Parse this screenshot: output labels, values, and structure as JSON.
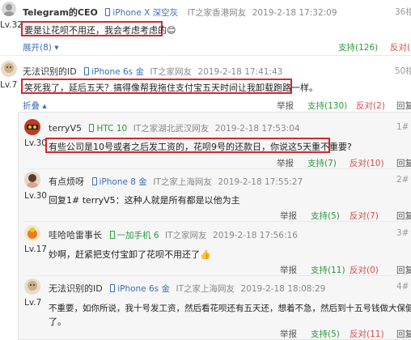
{
  "comments": [
    {
      "user": "Telegram的CEO",
      "device": "iPhone X 深空灰",
      "source": "IT之家香港网友",
      "time": "2019-2-18 17:32:09",
      "floor": "36楼",
      "level": "Lv.32",
      "content": "要是让花呗不用还，我会考虑考虑的😊",
      "expand": "展开(8)",
      "support": "支持(126)",
      "oppose": "反对(0"
    },
    {
      "user": "无法识别的ID",
      "device": "iPhone 6s 金",
      "source": "IT之家网友",
      "time": "2019-2-18 17:41:43",
      "floor": "50楼",
      "level": "Lv.7",
      "content": "笑死我了，延后五天？搞得像帮我拖住支付宝五天时间让我卸载跑路一样。",
      "collapse": "折叠",
      "report": "举报",
      "support": "支持(130)",
      "oppose": "反对(2)",
      "reply": "回复"
    }
  ],
  "replies": [
    {
      "user": "terryV5",
      "device": "HTC 10",
      "source": "IT之家湖北武汉网友",
      "time": "2019-2-18 17:53:04",
      "floor": "1#",
      "level": "Lv.30",
      "content": "有些公司是10号或者之后发工资的，花呗9号的还款日，你说这5天重不重要?",
      "report": "举报",
      "support": "支持(7)",
      "oppose": "反对(10)",
      "reply": "回复"
    },
    {
      "user": "有点烦呀",
      "device": "iPhone 8 金",
      "source": "IT之家上海网友",
      "time": "2019-2-18 17:55:27",
      "floor": "2#",
      "level": "Lv.30",
      "content": "回复1# terryV5：这种人就是所有都是以他为主",
      "report": "举报",
      "support": "支持(5)",
      "oppose": "反对(7)",
      "reply": "回复"
    },
    {
      "user": "哇哈哈雷事长",
      "device": "一加手机 6",
      "source": "IT之家网友",
      "time": "2019-2-18 17:56:16",
      "floor": "3#",
      "level": "Lv.17",
      "content": "妙啊，赶紧把支付宝卸了花呗不用还了👍",
      "report": "举报",
      "support": "支持(11)",
      "oppose": "反对(0)",
      "reply": "回复"
    },
    {
      "user": "无法识别的ID",
      "device": "iPhone 6s 金",
      "source": "IT之家上海网友",
      "time": "2019-2-18 18:08:29",
      "floor": "4#",
      "level": "Lv.7",
      "content_line1": "不重要，如你所说，我十号发工资，然后看花呗还有五天还，想着不急，然后到十五号钱做大保健花完",
      "content_line2": "了。",
      "report": "举报",
      "support": "支持(5)",
      "oppose": "反对(11)",
      "reply": "回复"
    }
  ],
  "colors": {
    "highlight": "#d8262d",
    "support": "#2b9a3c",
    "oppose": "#d84b4b",
    "device": "#3a6fb5"
  }
}
